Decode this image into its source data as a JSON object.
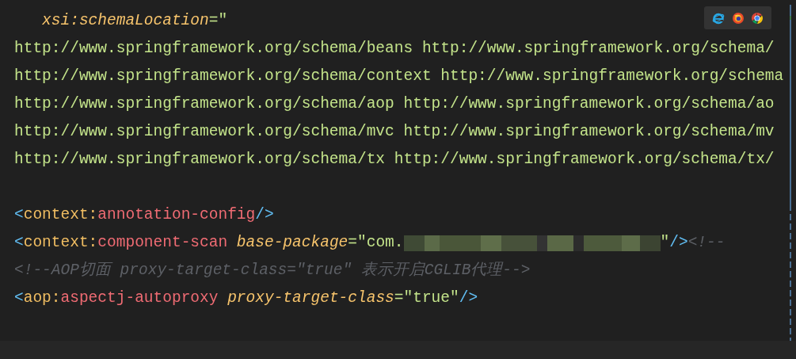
{
  "editor": {
    "lines": [
      {
        "kind": "continuation",
        "tokens": [
          {
            "kind": "attribute",
            "text": "xsi:schemaLocation"
          },
          {
            "kind": "string",
            "text": "=\""
          }
        ]
      },
      {
        "tokens": [
          {
            "kind": "string",
            "text": "http://www.springframework.org/schema/beans http://www.springframework.org/schema/"
          }
        ]
      },
      {
        "tokens": [
          {
            "kind": "string",
            "text": "http://www.springframework.org/schema/context http://www.springframework.org/schema"
          }
        ]
      },
      {
        "tokens": [
          {
            "kind": "string",
            "text": "http://www.springframework.org/schema/aop http://www.springframework.org/schema/ao"
          }
        ]
      },
      {
        "tokens": [
          {
            "kind": "string",
            "text": "http://www.springframework.org/schema/mvc http://www.springframework.org/schema/mv"
          }
        ]
      },
      {
        "tokens": [
          {
            "kind": "string",
            "text": "http://www.springframework.org/schema/tx http://www.springframework.org/schema/tx/"
          }
        ]
      },
      {
        "kind": "blank"
      },
      {
        "tokens": [
          {
            "kind": "bracket",
            "text": "<"
          },
          {
            "kind": "namespace",
            "text": "context:"
          },
          {
            "kind": "tag",
            "text": "annotation-config"
          },
          {
            "kind": "bracket",
            "text": "/>"
          }
        ]
      },
      {
        "tokens": [
          {
            "kind": "bracket",
            "text": "<"
          },
          {
            "kind": "namespace",
            "text": "context:"
          },
          {
            "kind": "tag",
            "text": "component-scan "
          },
          {
            "kind": "attribute",
            "text": "base-package"
          },
          {
            "kind": "string",
            "text": "=\"com."
          },
          {
            "kind": "redacted"
          },
          {
            "kind": "string",
            "text": "\""
          },
          {
            "kind": "bracket",
            "text": "/>"
          },
          {
            "kind": "comment",
            "text": "<!--"
          }
        ]
      },
      {
        "tokens": [
          {
            "kind": "comment",
            "text": "<!--AOP切面 proxy-target-class=\"true\" 表示开启CGLIB代理-->"
          }
        ]
      },
      {
        "tokens": [
          {
            "kind": "bracket",
            "text": "<"
          },
          {
            "kind": "namespace",
            "text": "aop:"
          },
          {
            "kind": "tag",
            "text": "aspectj-autoproxy "
          },
          {
            "kind": "attribute",
            "text": "proxy-target-class"
          },
          {
            "kind": "string",
            "text": "=\"true\""
          },
          {
            "kind": "bracket",
            "text": "/>"
          }
        ]
      }
    ]
  },
  "browser_bar": {
    "icons": [
      {
        "kind": "e-ring"
      },
      {
        "kind": "flame-ring"
      },
      {
        "kind": "segmented-ring"
      }
    ]
  }
}
